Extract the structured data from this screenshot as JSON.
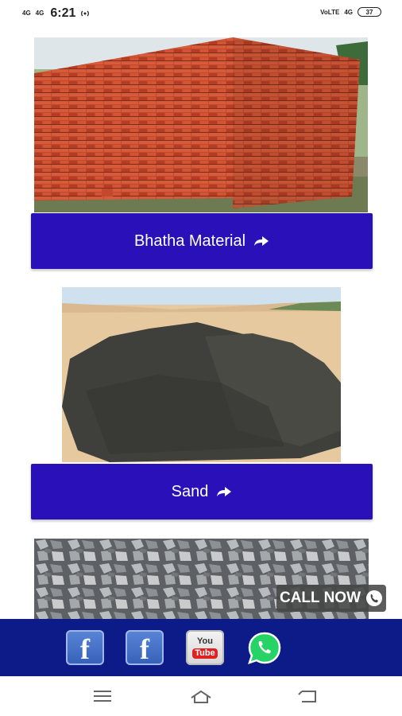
{
  "status_bar": {
    "network_left_1": "4G",
    "network_left_2": "4G",
    "time": "6:21",
    "volte_label": "VoLTE",
    "network_right": "4G",
    "battery": "37"
  },
  "products": [
    {
      "button_label": "Bhatha Material",
      "image_name": "bricks-image"
    },
    {
      "button_label": "Sand",
      "image_name": "sand-image"
    },
    {
      "button_label": "",
      "image_name": "gravel-image"
    }
  ],
  "call_now": {
    "label": "CALL NOW"
  },
  "social": {
    "facebook_letter": "f",
    "youtube_top": "You",
    "youtube_bottom": "Tube",
    "icons": [
      "facebook-icon",
      "facebook-icon",
      "youtube-icon",
      "whatsapp-icon"
    ]
  },
  "colors": {
    "button_bg": "#2a10b8",
    "social_bar_bg": "#0c1b87",
    "call_now_bg": "#464646"
  }
}
